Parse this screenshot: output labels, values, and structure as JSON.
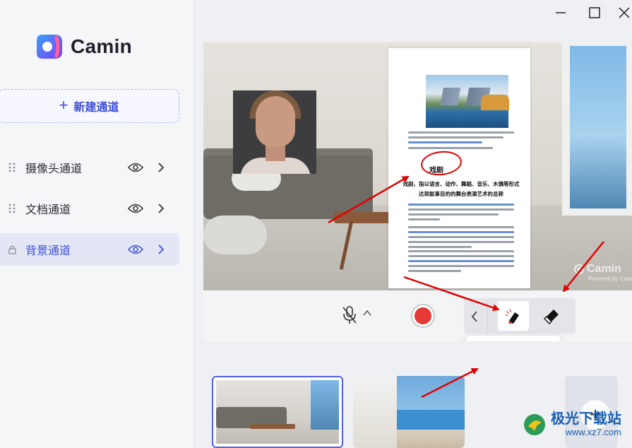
{
  "app": {
    "name": "Camin"
  },
  "sidebar": {
    "new_channel_label": "新建通道",
    "items": [
      {
        "label": "摄像头通道",
        "active": false
      },
      {
        "label": "文档通道",
        "active": false
      },
      {
        "label": "背景通道",
        "active": true
      }
    ]
  },
  "preview": {
    "doc_title": "戏剧",
    "doc_heading": "戏剧，指以语言、动作、舞蹈、音乐、木偶等形式达到叙事目的的舞台表演艺术的总称",
    "watermark": "Camin",
    "watermark_sub": "Powered by Classin"
  },
  "popover": {
    "swatches": [
      "#ffffff",
      "#9e9e9e",
      "#555a66",
      "#111111",
      "#ffffff",
      "#f07f1e",
      "#f2c200",
      "#6dc24b",
      "#18c7c2",
      "#1e88e5",
      "#6c4fd0",
      "#ffffff"
    ],
    "selected_swatch": 4,
    "selected_swatch_color": "#e53935"
  },
  "site_watermark": {
    "line1": "极光下载站",
    "line2": "www.xz7.com"
  },
  "colors": {
    "accent": "#3e4fd8",
    "record": "#e53935",
    "annotation": "#e00000"
  }
}
